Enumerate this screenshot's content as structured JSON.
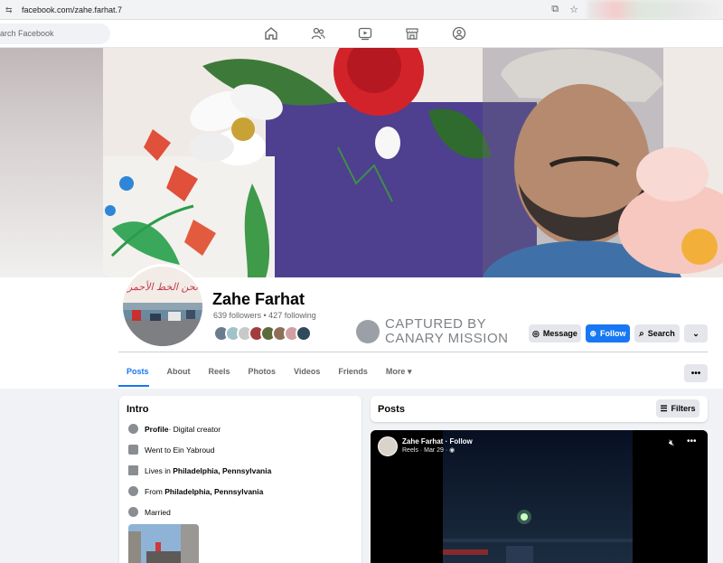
{
  "browser": {
    "url": "facebook.com/zahe.farhat.7"
  },
  "nav": {
    "search_placeholder": "arch Facebook"
  },
  "profile": {
    "name": "Zahe Farhat",
    "followers_line": "639 followers • 427 following",
    "avatar_text": "نحن الخط الأحمر"
  },
  "watermark": {
    "line1": "CAPTURED BY",
    "line2": "CANARY MISSION"
  },
  "actions": {
    "message": "Message",
    "follow": "Follow",
    "search": "Search"
  },
  "tabs": [
    "Posts",
    "About",
    "Reels",
    "Photos",
    "Videos",
    "Friends",
    "More"
  ],
  "intro": {
    "title": "Intro",
    "profile_label": "Profile",
    "profile_text": " · Digital creator",
    "school": "Went to Ein Yabroud",
    "lives_prefix": "Lives in ",
    "lives_place": "Philadelphia, Pennsylvania",
    "from_prefix": "From ",
    "from_place": "Philadelphia, Pennsylvania",
    "relationship": "Married"
  },
  "posts": {
    "title": "Posts",
    "filters": "Filters",
    "reel_author": "Zahe Farhat · Follow",
    "reel_meta": "Reels · Mar 29 · ◉"
  },
  "colors": {
    "accent": "#1877f2"
  }
}
